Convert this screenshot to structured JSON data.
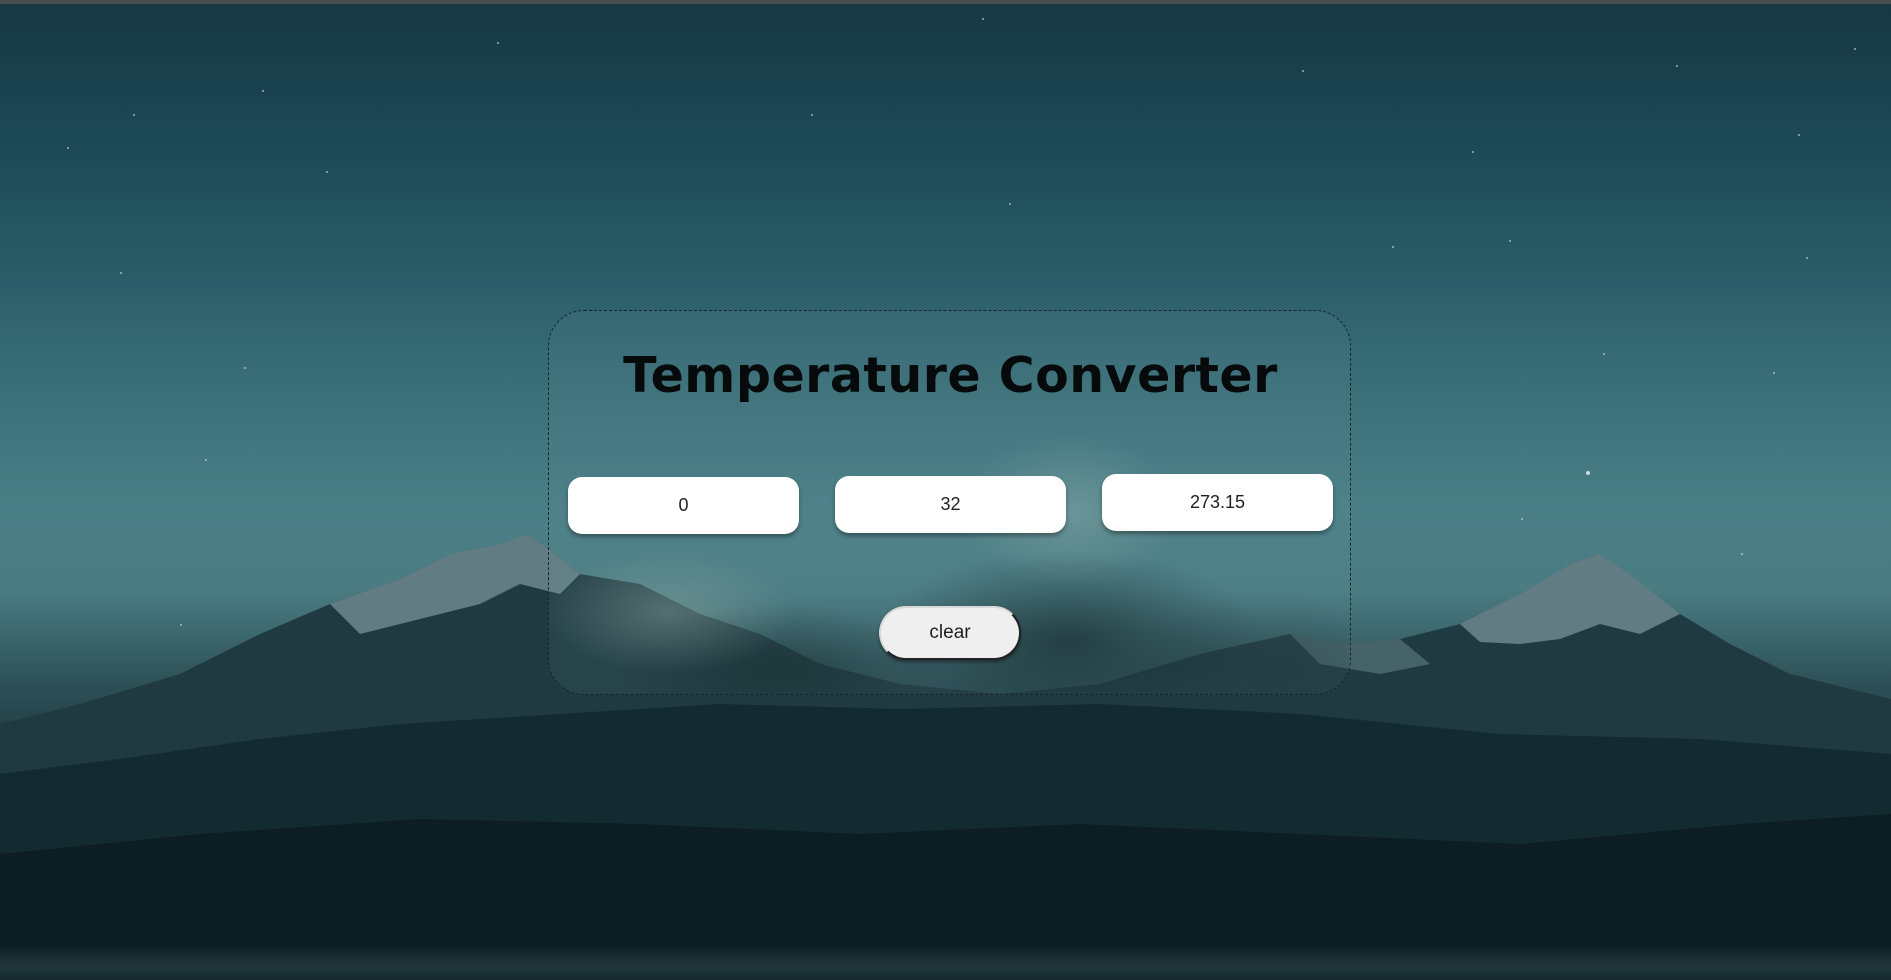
{
  "app": {
    "title": "Temperature Converter"
  },
  "inputs": {
    "celsius": {
      "value": "0"
    },
    "fahrenheit": {
      "value": "32"
    },
    "kelvin": {
      "value": "273.15"
    }
  },
  "actions": {
    "clear_label": "clear"
  },
  "colors": {
    "sky_top": "#173844",
    "sky_mid": "#4b7f86",
    "ground": "#0b1a1f",
    "title_text": "#060a0b",
    "field_bg": "#ffffff",
    "button_bg": "#efefef"
  }
}
